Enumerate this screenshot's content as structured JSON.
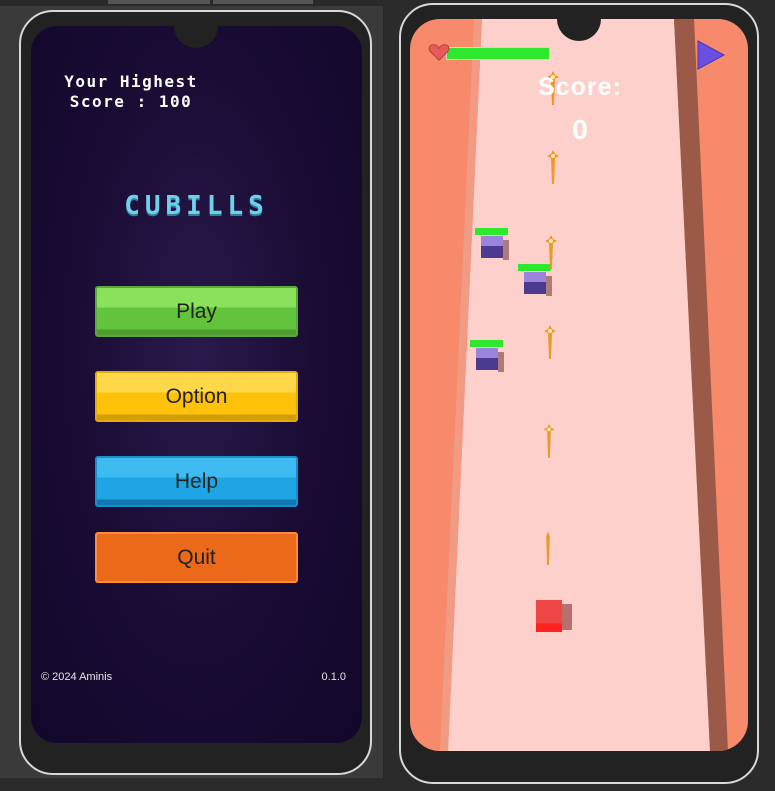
{
  "menu_screen": {
    "highscore_line1": "Your Highest",
    "highscore_line2": "Score : 100",
    "title": "CUBILLS",
    "buttons": {
      "play": "Play",
      "option": "Option",
      "help": "Help",
      "quit": "Quit"
    },
    "copyright": "© 2024 Aminis",
    "version": "0.1.0"
  },
  "game_screen": {
    "score_label": "Score:",
    "score_value": "0",
    "health_fraction": 1.0,
    "icons": {
      "health": "heart-icon",
      "play": "play-icon"
    },
    "colors": {
      "road": "#fdd0cc",
      "walls": "#f68a6a",
      "enemy": "#9a84dc",
      "player": "#f04545",
      "health": "#2ee82e"
    }
  }
}
